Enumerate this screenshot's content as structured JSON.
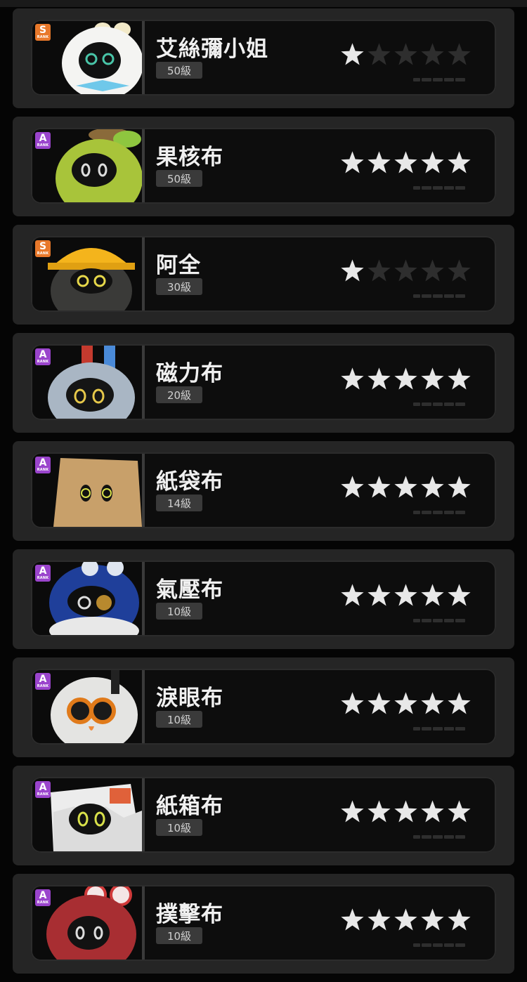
{
  "colors": {
    "rank_s": "#e8782a",
    "rank_a": "#9a44cc",
    "star_on": "#e8e8e8",
    "star_off": "#2e2e2e"
  },
  "rank_sub": "RANK",
  "characters": [
    {
      "name": "艾絲彌小姐",
      "level": "50級",
      "rank": "S",
      "stars": 1,
      "portrait": "white-bunny-bow"
    },
    {
      "name": "果核布",
      "level": "50級",
      "rank": "A",
      "stars": 5,
      "portrait": "green-fruit-leaf"
    },
    {
      "name": "阿全",
      "level": "30級",
      "rank": "S",
      "stars": 1,
      "portrait": "hardhat-worker"
    },
    {
      "name": "磁力布",
      "level": "20級",
      "rank": "A",
      "stars": 5,
      "portrait": "magnet-robot"
    },
    {
      "name": "紙袋布",
      "level": "14級",
      "rank": "A",
      "stars": 5,
      "portrait": "paper-bag"
    },
    {
      "name": "氣壓布",
      "level": "10級",
      "rank": "A",
      "stars": 5,
      "portrait": "blue-pressure-gauge"
    },
    {
      "name": "淚眼布",
      "level": "10級",
      "rank": "A",
      "stars": 5,
      "portrait": "orange-glasses"
    },
    {
      "name": "紙箱布",
      "level": "10級",
      "rank": "A",
      "stars": 5,
      "portrait": "cardboard-box"
    },
    {
      "name": "撲擊布",
      "level": "10級",
      "rank": "A",
      "stars": 5,
      "portrait": "red-swirl-hood"
    }
  ]
}
